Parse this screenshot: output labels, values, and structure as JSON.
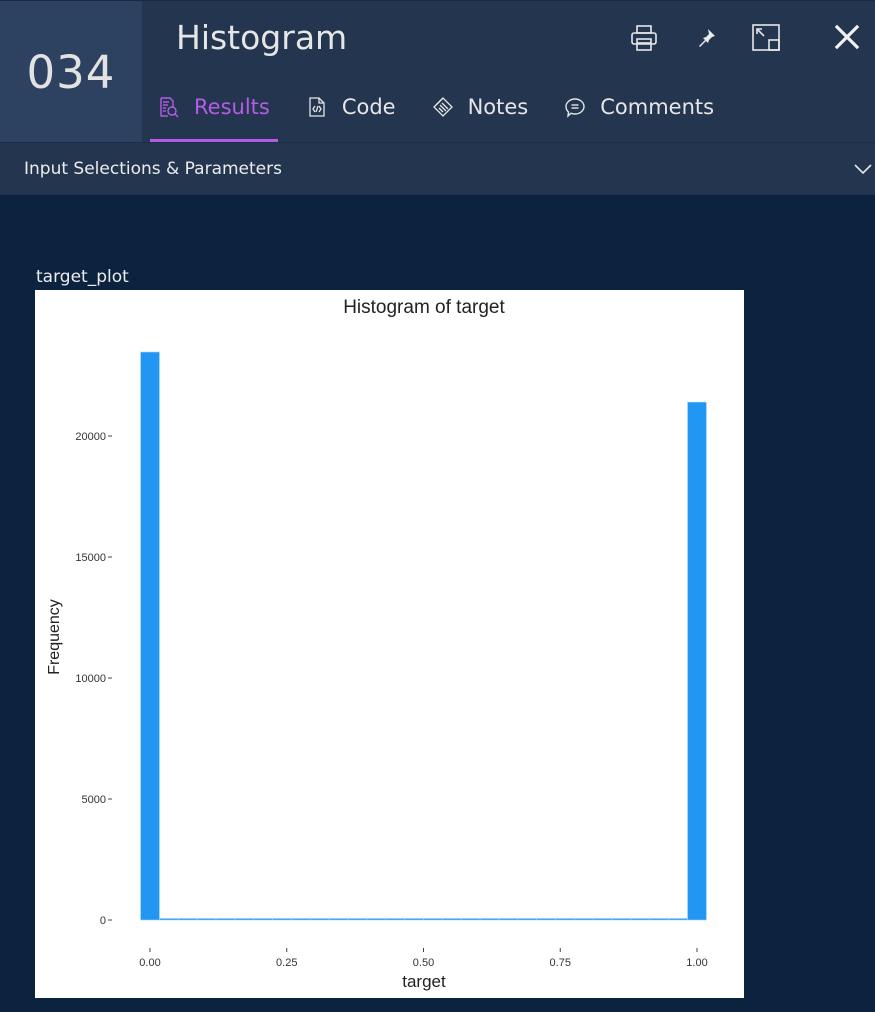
{
  "header": {
    "number": "034",
    "title": "Histogram",
    "icons": [
      "print-icon",
      "pin-icon",
      "expand-icon",
      "close-icon"
    ]
  },
  "tabs": [
    {
      "label": "Results",
      "icon": "results-icon",
      "active": true
    },
    {
      "label": "Code",
      "icon": "code-icon",
      "active": false
    },
    {
      "label": "Notes",
      "icon": "notes-icon",
      "active": false
    },
    {
      "label": "Comments",
      "icon": "comments-icon",
      "active": false
    }
  ],
  "params": {
    "label": "Input Selections & Parameters"
  },
  "plot_label": "target_plot",
  "colors": {
    "accent": "#b35de6",
    "bar": "#2196f3",
    "background": "#0c2340",
    "header": "#243550"
  },
  "chart_data": {
    "type": "bar",
    "title": "Histogram of target",
    "xlabel": "target",
    "ylabel": "Frequency",
    "bins": 30,
    "x_range": [
      -0.0172,
      1.0172
    ],
    "xlim": [
      -0.07,
      1.07
    ],
    "ylim": [
      -1200,
      25500
    ],
    "x_ticks": [
      0.0,
      0.25,
      0.5,
      0.75,
      1.0
    ],
    "x_tick_labels": [
      "0.00",
      "0.25",
      "0.50",
      "0.75",
      "1.00"
    ],
    "y_ticks": [
      0,
      5000,
      10000,
      15000,
      20000
    ],
    "y_tick_labels": [
      "0",
      "5000",
      "10000",
      "15000",
      "20000"
    ],
    "values": [
      23470,
      0,
      0,
      0,
      0,
      0,
      0,
      0,
      0,
      0,
      0,
      0,
      0,
      0,
      0,
      0,
      0,
      0,
      0,
      0,
      0,
      0,
      0,
      0,
      0,
      0,
      0,
      0,
      0,
      21400
    ],
    "grid": false,
    "legend": "none"
  }
}
